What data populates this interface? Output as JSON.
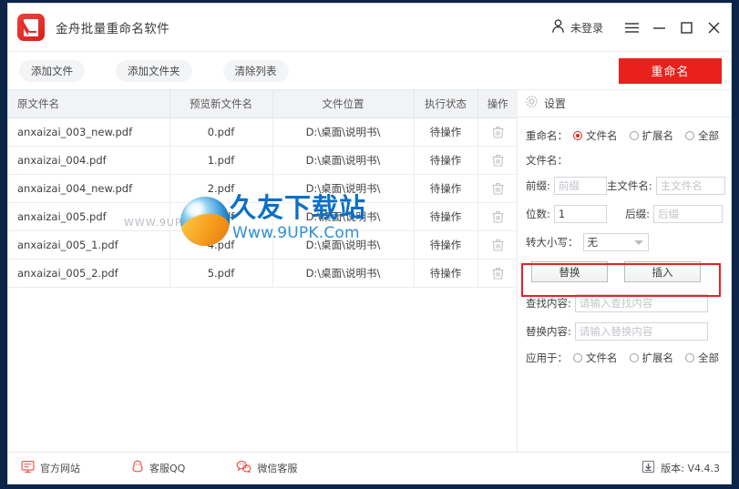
{
  "window": {
    "app_title": "金舟批量重命名软件",
    "logo_icon": "rename-app-logo-icon",
    "user": {
      "icon": "user-account-icon",
      "label": "未登录"
    },
    "controls": {
      "menu": "menu-hamburger-icon",
      "minimize": "minimize-icon",
      "maximize": "maximize-icon",
      "close": "close-icon"
    }
  },
  "toolbar": {
    "add_file": "添加文件",
    "add_folder": "添加文件夹",
    "clear_list": "清除列表",
    "rename": "重命名",
    "rename_color": "#e8211c"
  },
  "table": {
    "headers": [
      "原文件名",
      "预览新文件名",
      "文件位置",
      "执行状态",
      "操作"
    ],
    "delete_icon": "trash-icon",
    "rows": [
      {
        "original": "anxaizai_003_new.pdf",
        "preview": "0.pdf",
        "location": "D:\\桌面\\说明书\\",
        "status": "待操作"
      },
      {
        "original": "anxaizai_004.pdf",
        "preview": "1.pdf",
        "location": "D:\\桌面\\说明书\\",
        "status": "待操作"
      },
      {
        "original": "anxaizai_004_new.pdf",
        "preview": "2.pdf",
        "location": "D:\\桌面\\说明书\\",
        "status": "待操作"
      },
      {
        "original": "anxaizai_005.pdf",
        "preview": "3.pdf",
        "location": "D:\\桌面\\说明书\\",
        "status": "待操作"
      },
      {
        "original": "anxaizai_005_1.pdf",
        "preview": "4.pdf",
        "location": "D:\\桌面\\说明书\\",
        "status": "待操作"
      },
      {
        "original": "anxaizai_005_2.pdf",
        "preview": "5.pdf",
        "location": "D:\\桌面\\说明书\\",
        "status": "待操作"
      }
    ]
  },
  "watermark": {
    "url_small": "WWW.9UPK.COM",
    "cn": "久友下载站",
    "en": "Www.9UPK.Com"
  },
  "settings": {
    "icon": "gear-icon",
    "title": "设置",
    "rename_label": "重命名：",
    "rename_options": [
      "文件名",
      "扩展名",
      "全部"
    ],
    "rename_selected": "文件名",
    "filename_label": "文件名：",
    "prefix_label": "前缀:",
    "prefix_value": "",
    "prefix_placeholder": "前缀",
    "mainname_label": "主文件名:",
    "mainname_value": "",
    "mainname_placeholder": "主文件名",
    "digits_label": "位数:",
    "digits_value": "1",
    "suffix_label": "后缀:",
    "suffix_value": "",
    "suffix_placeholder": "后缀",
    "case_label": "转大小写：",
    "case_value": "无",
    "replace_button": "替换",
    "insert_button": "插入",
    "find_label": "查找内容:",
    "find_value": "",
    "find_placeholder": "请输入查找内容",
    "replace_label": "替换内容:",
    "replace_value": "",
    "replace_placeholder": "请输入替换内容",
    "applyto_label": "应用于：",
    "applyto_options": [
      "文件名",
      "扩展名",
      "全部"
    ],
    "applyto_selected": "",
    "highlight_color": "#ee2020"
  },
  "statusbar": {
    "website": {
      "icon": "monitor-website-icon",
      "label": "官方网站"
    },
    "qq": {
      "icon": "qq-penguin-icon",
      "label": "客服QQ"
    },
    "wechat": {
      "icon": "wechat-icon",
      "label": "微信客服"
    },
    "version": {
      "icon": "download-update-icon",
      "label": "版本: V4.4.3"
    }
  }
}
